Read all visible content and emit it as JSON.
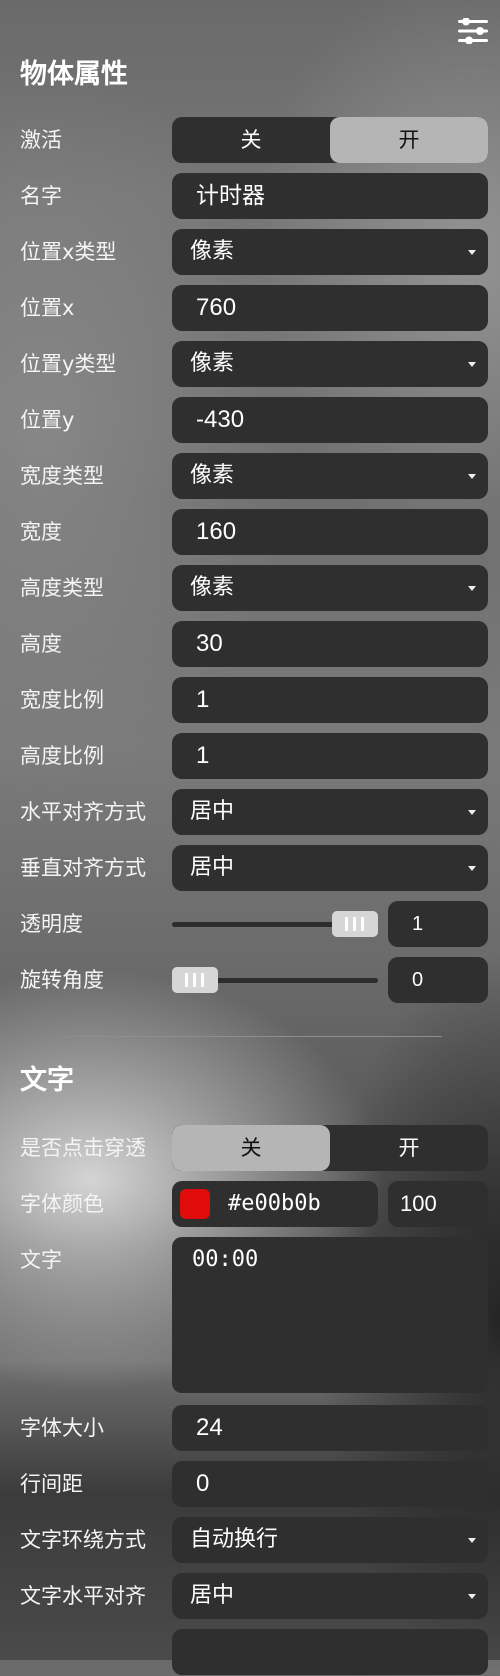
{
  "header": {
    "menu_icon": "sliders-menu-icon"
  },
  "object_props": {
    "title": "物体属性",
    "active": {
      "label": "激活",
      "off": "关",
      "on": "开",
      "selected": "on"
    },
    "name": {
      "label": "名字",
      "value": "计时器"
    },
    "pos_x_type": {
      "label": "位置x类型",
      "value": "像素"
    },
    "pos_x": {
      "label": "位置x",
      "value": "760"
    },
    "pos_y_type": {
      "label": "位置y类型",
      "value": "像素"
    },
    "pos_y": {
      "label": "位置y",
      "value": "-430"
    },
    "width_type": {
      "label": "宽度类型",
      "value": "像素"
    },
    "width": {
      "label": "宽度",
      "value": "160"
    },
    "height_type": {
      "label": "高度类型",
      "value": "像素"
    },
    "height": {
      "label": "高度",
      "value": "30"
    },
    "width_scale": {
      "label": "宽度比例",
      "value": "1"
    },
    "height_scale": {
      "label": "高度比例",
      "value": "1"
    },
    "h_align": {
      "label": "水平对齐方式",
      "value": "居中"
    },
    "v_align": {
      "label": "垂直对齐方式",
      "value": "居中"
    },
    "opacity": {
      "label": "透明度",
      "value": "1",
      "fraction": 1
    },
    "rotation": {
      "label": "旋转角度",
      "value": "0",
      "fraction": 0
    }
  },
  "text_props": {
    "title": "文字",
    "click_through": {
      "label": "是否点击穿透",
      "off": "关",
      "on": "开",
      "selected": "off"
    },
    "font_color": {
      "label": "字体颜色",
      "hex": "#e00b0b",
      "alpha": "100"
    },
    "text": {
      "label": "文字",
      "value": "00:00"
    },
    "font_size": {
      "label": "字体大小",
      "value": "24"
    },
    "line_spacing": {
      "label": "行间距",
      "value": "0"
    },
    "wrap_mode": {
      "label": "文字环绕方式",
      "value": "自动换行"
    },
    "text_h_align": {
      "label": "文字水平对齐",
      "value": "居中"
    }
  }
}
